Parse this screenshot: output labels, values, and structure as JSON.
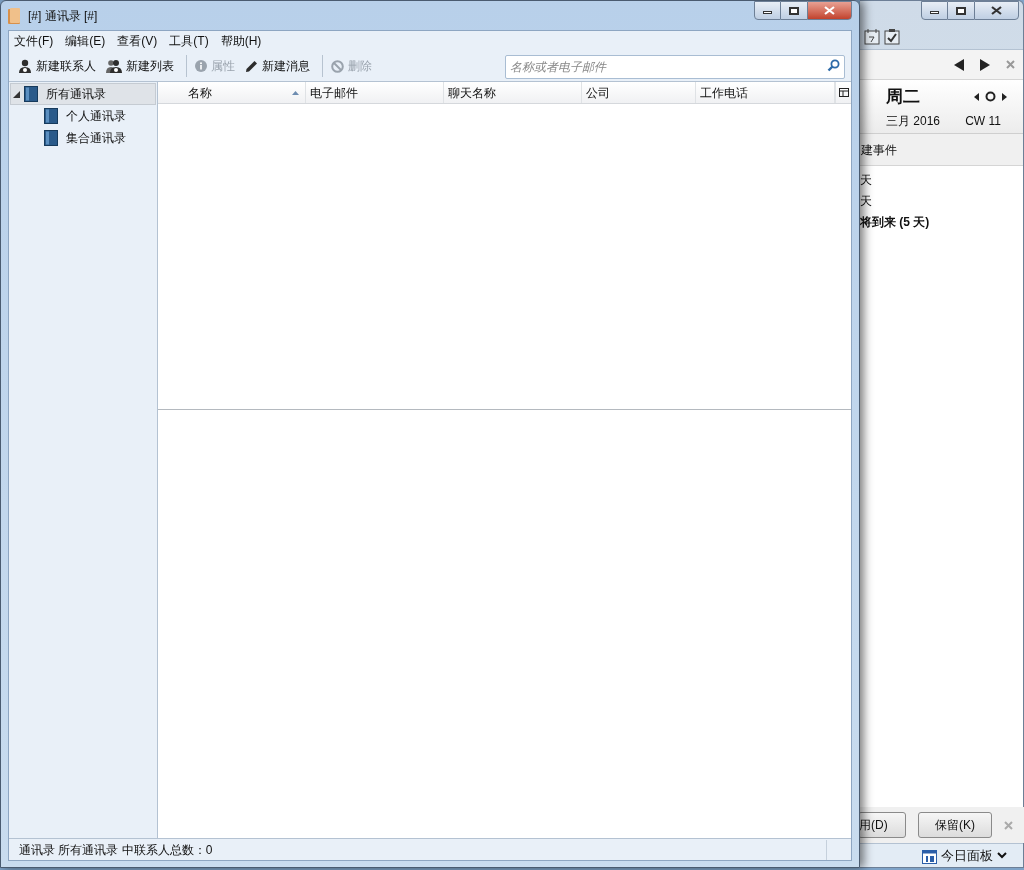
{
  "window": {
    "title": "[#] 通讯录 [#]"
  },
  "menu": [
    {
      "label": "文件(F)"
    },
    {
      "label": "编辑(E)"
    },
    {
      "label": "查看(V)"
    },
    {
      "label": "工具(T)"
    },
    {
      "label": "帮助(H)"
    }
  ],
  "toolbar": [
    {
      "label": "新建联系人",
      "disabled": false
    },
    {
      "label": "新建列表",
      "disabled": false
    },
    {
      "label": "属性",
      "disabled": true
    },
    {
      "label": "新建消息",
      "disabled": false
    },
    {
      "label": "删除",
      "disabled": true
    }
  ],
  "search": {
    "placeholder": "名称或者电子邮件"
  },
  "sidebar": {
    "items": [
      {
        "label": "所有通讯录",
        "selected": true,
        "expanded": true,
        "children": [
          {
            "label": "个人通讯录",
            "selected": false
          },
          {
            "label": "集合通讯录",
            "selected": false
          }
        ]
      }
    ]
  },
  "table": {
    "columns": [
      {
        "label": "名称",
        "sorted": true
      },
      {
        "label": "电子邮件",
        "sorted": false
      },
      {
        "label": "聊天名称",
        "sorted": false
      },
      {
        "label": "公司",
        "sorted": false
      },
      {
        "label": "工作电话",
        "sorted": false
      }
    ]
  },
  "status_bar": "通讯录 所有通讯录 中联系人总数：0",
  "today_pane": {
    "weekday": "周二",
    "month_year": "三月 2016",
    "week": "CW 11",
    "new_event": "建事件",
    "groups": [
      {
        "label": "天",
        "bold": false
      },
      {
        "label": "天",
        "bold": false
      },
      {
        "label": "将到来 (5 天)",
        "bold": true
      }
    ],
    "buttons": [
      "用(D)",
      "保留(K)"
    ],
    "pane_label": "今日面板"
  }
}
